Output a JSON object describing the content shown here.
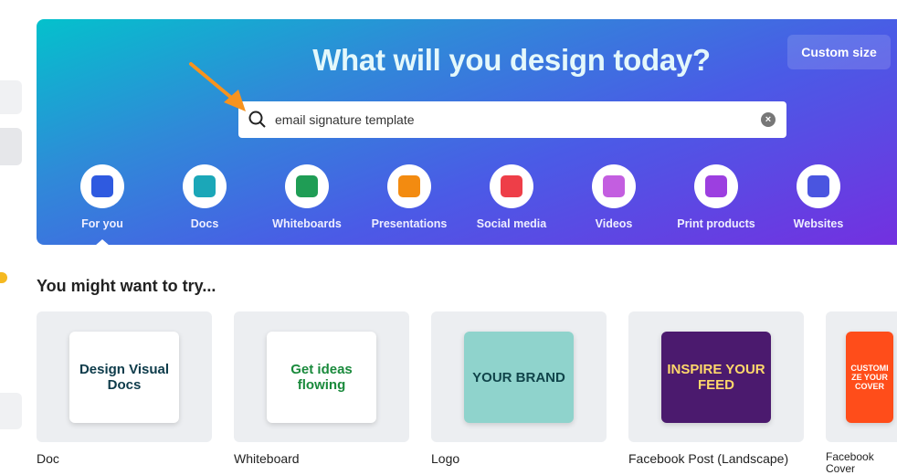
{
  "banner": {
    "title": "What will you design today?",
    "custom_size": "Custom size"
  },
  "search": {
    "value": "email signature template"
  },
  "categories": [
    {
      "label": "For you",
      "icon": "sparkle-icon",
      "color": "#2f5ae0"
    },
    {
      "label": "Docs",
      "icon": "doc-icon",
      "color": "#1ba7b8"
    },
    {
      "label": "Whiteboards",
      "icon": "whiteboard-icon",
      "color": "#1f9d55"
    },
    {
      "label": "Presentations",
      "icon": "presentation-icon",
      "color": "#f38b10"
    },
    {
      "label": "Social media",
      "icon": "heart-icon",
      "color": "#ee3e48"
    },
    {
      "label": "Videos",
      "icon": "video-icon",
      "color": "#c35ee0"
    },
    {
      "label": "Print products",
      "icon": "printer-icon",
      "color": "#9c3fe0"
    },
    {
      "label": "Websites",
      "icon": "website-icon",
      "color": "#4a55e0"
    }
  ],
  "section": {
    "title": "You might want to try..."
  },
  "cards": [
    {
      "label": "Doc",
      "art": "Design Visual Docs"
    },
    {
      "label": "Whiteboard",
      "art": "Get ideas flowing"
    },
    {
      "label": "Logo",
      "art": "YOUR BRAND"
    },
    {
      "label": "Facebook Post (Landscape)",
      "art": "INSPIRE YOUR FEED"
    },
    {
      "label": "Facebook Cover",
      "art": "CUSTOMIZE YOUR COVER"
    }
  ]
}
